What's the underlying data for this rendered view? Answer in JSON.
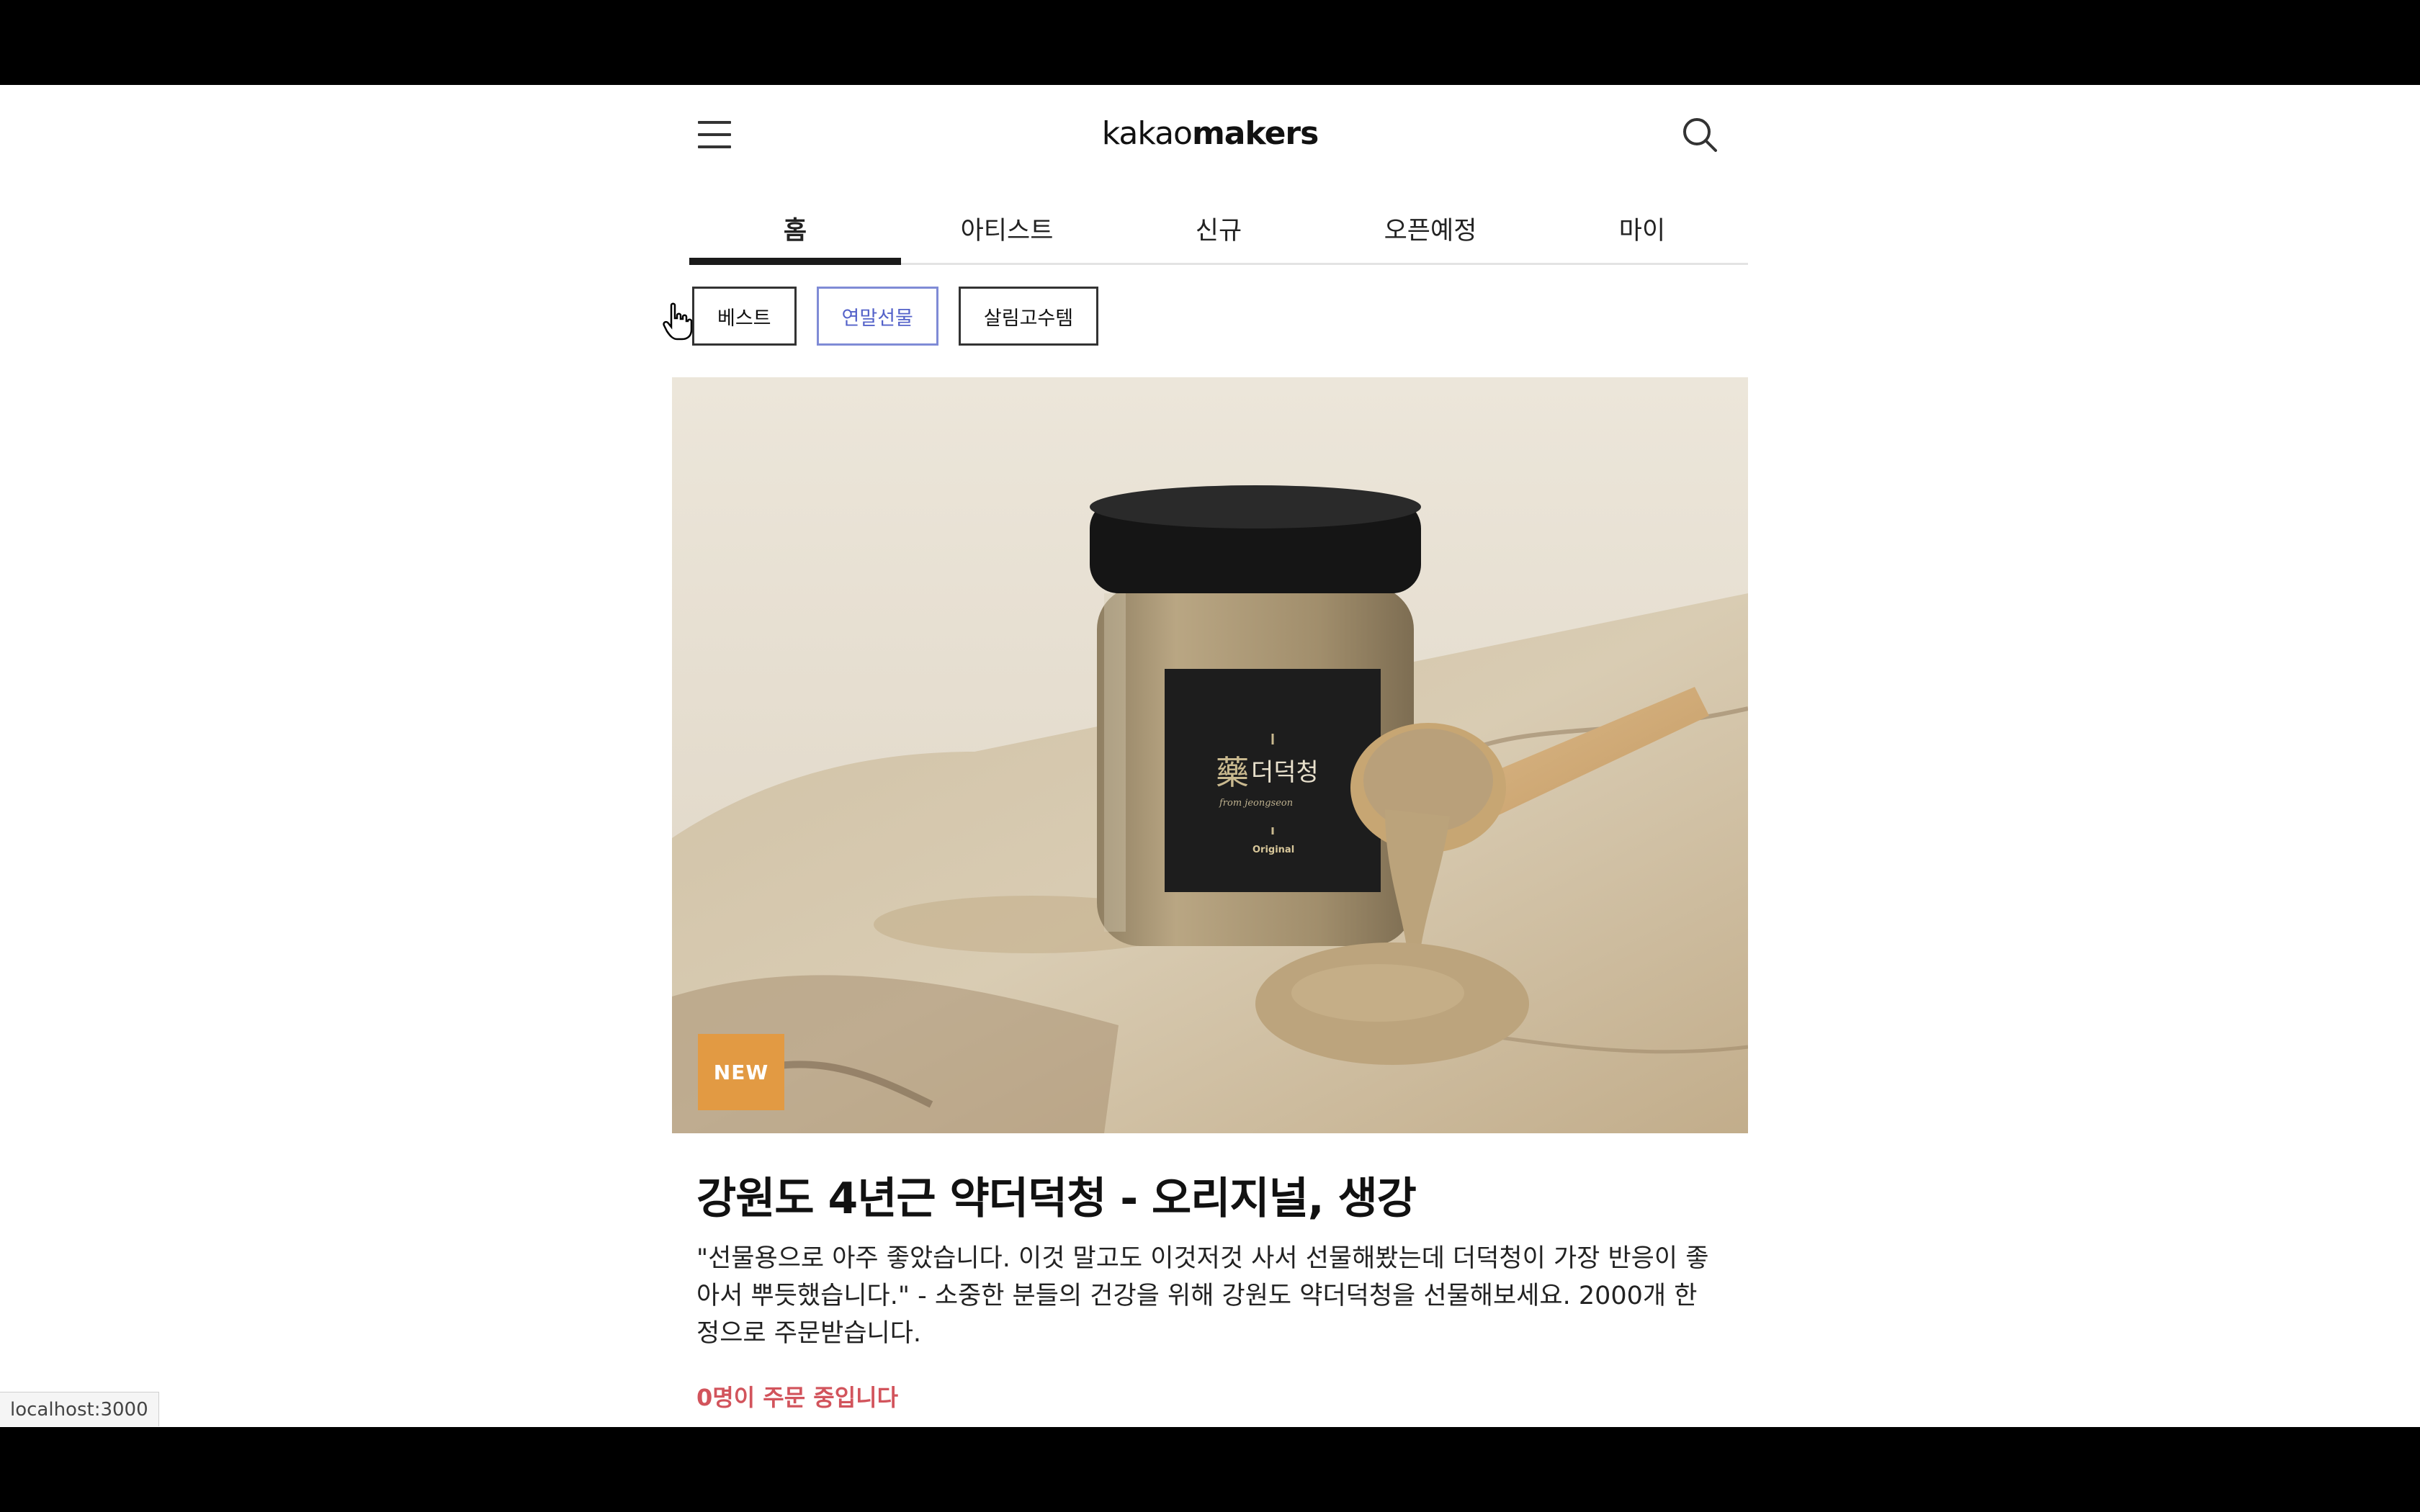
{
  "header": {
    "logo_light": "kakao",
    "logo_bold": "makers"
  },
  "tabs": [
    {
      "label": "홈",
      "active": true
    },
    {
      "label": "아티스트"
    },
    {
      "label": "신규"
    },
    {
      "label": "오픈예정"
    },
    {
      "label": "마이"
    }
  ],
  "chips": [
    {
      "label": "베스트"
    },
    {
      "label": "연말선물",
      "selected": true
    },
    {
      "label": "살림고수템"
    }
  ],
  "hero": {
    "badge": "NEW",
    "jar_label_hanja": "藥",
    "jar_label_text": "더덕청",
    "jar_label_small": "from jeongseon",
    "jar_label_variant": "Original"
  },
  "product": {
    "title": "강원도 4년근 약더덕청 - 오리지널, 생강",
    "description": "\"선물용으로 아주 좋았습니다. 이것 말고도 이것저것 사서 선물해봤는데 더덕청이 가장 반응이 좋아서 뿌듯했습니다.\" - 소중한 분들의 건강을 위해 강원도 약더덕청을 선물해보세요. 2000개 한정으로 주문받습니다.",
    "orders": "0명이 주문 중입니다"
  },
  "status_bar": "localhost:3000",
  "colors": {
    "accent_badge": "#e29a43",
    "selected_chip": "#5462c9",
    "orders_text": "#d2545c"
  }
}
